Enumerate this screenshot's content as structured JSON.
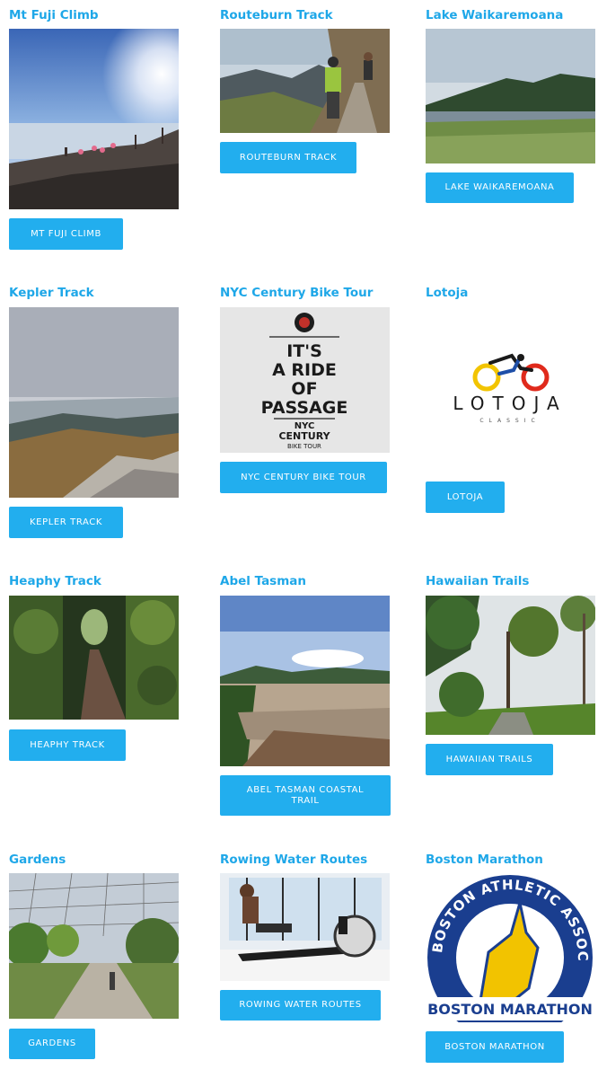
{
  "items": [
    {
      "title": "Mt Fuji Climb",
      "button": "MT FUJI CLIMB"
    },
    {
      "title": "Routeburn Track",
      "button": "ROUTEBURN TRACK"
    },
    {
      "title": "Lake Waikaremoana",
      "button": "LAKE WAIKAREMOANA"
    },
    {
      "title": "Kepler Track",
      "button": "KEPLER TRACK"
    },
    {
      "title": "NYC Century Bike Tour",
      "button": "NYC CENTURY BIKE TOUR"
    },
    {
      "title": "Lotoja",
      "button": "LOTOJA"
    },
    {
      "title": "Heaphy Track",
      "button": "HEAPHY TRACK"
    },
    {
      "title": "Abel Tasman",
      "button": "ABEL TASMAN COASTAL TRAIL"
    },
    {
      "title": "Hawaiian Trails",
      "button": "HAWAIIAN TRAILS"
    },
    {
      "title": "Gardens",
      "button": "GARDENS"
    },
    {
      "title": "Rowing Water Routes",
      "button": "ROWING WATER ROUTES"
    },
    {
      "title": "Boston Marathon",
      "button": "BOSTON MARATHON"
    }
  ],
  "logos": {
    "nyc_poster": {
      "line1": "IT'S",
      "line2": "A RIDE",
      "line3": "OF",
      "line4": "PASSAGE",
      "line5": "NYC",
      "line6": "CENTURY",
      "line7": "BIKE TOUR"
    },
    "lotoja": {
      "name": "LOTOJA",
      "sub": "CLASSIC"
    },
    "boston": {
      "top": "BOSTON ATHLETIC ASSOCIATION",
      "bottom": "BOSTON MARATHON"
    }
  },
  "colors": {
    "accent": "#1ea7e8",
    "button": "#22aeee"
  }
}
